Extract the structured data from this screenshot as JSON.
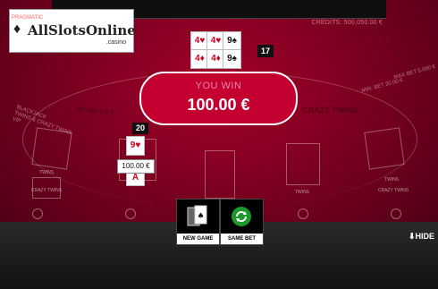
{
  "header": {
    "credits": "CREDITS: 500,050.00 €"
  },
  "logo": {
    "brand": "AllSlotsOnline",
    "sub": ".casino",
    "provider": "PRAGMATIC"
  },
  "dealer": {
    "cards": [
      {
        "rank": "4",
        "suit": "♥",
        "color": "red"
      },
      {
        "rank": "4",
        "suit": "♥",
        "color": "red"
      },
      {
        "rank": "9",
        "suit": "♠",
        "color": "blk"
      },
      {
        "rank": "4",
        "suit": "♦",
        "color": "red"
      },
      {
        "rank": "4",
        "suit": "♦",
        "color": "red"
      },
      {
        "rank": "9",
        "suit": "♠",
        "color": "blk"
      }
    ],
    "score": "17"
  },
  "win_banner": {
    "label": "YOU WIN",
    "amount": "100.00 €"
  },
  "player": {
    "score": "20",
    "cards": [
      {
        "rank": "9",
        "suit": "♥"
      },
      {
        "rank": "A",
        "suit": "♥"
      }
    ],
    "bet": "100.00 €"
  },
  "table_text": {
    "blackjack_title": "BLACKJACK\nTWINS & CRAZY TWINS\nVIP",
    "min_max_left": "MIN. BET 20.00 €",
    "min_max_right": "MAX BET 5.000 €",
    "bj_pays": "BJ PAYS 3:2",
    "crazy_twins": "CRAZY TWINS",
    "twins_labels": [
      "TWINS",
      "CRAZY TWINS",
      "TWINS",
      "CRAZY TWINS",
      "TWINS",
      "CRAZY TWINS"
    ]
  },
  "buttons": {
    "new_game": "NEW GAME",
    "same_bet": "SAME BET"
  },
  "hide_label": "⬇HIDE",
  "colors": {
    "felt": "#7c0020",
    "banner": "#c3002f",
    "same_bet_green": "#1a9a2a"
  }
}
